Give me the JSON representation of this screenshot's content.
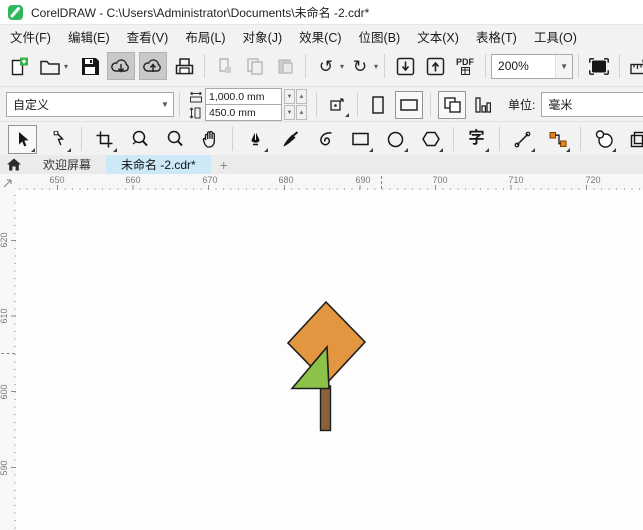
{
  "window": {
    "title": "CorelDRAW - C:\\Users\\Administrator\\Documents\\未命名 -2.cdr*"
  },
  "menu": {
    "items": [
      "文件(F)",
      "编辑(E)",
      "查看(V)",
      "布局(L)",
      "对象(J)",
      "效果(C)",
      "位图(B)",
      "文本(X)",
      "表格(T)",
      "工具(O)"
    ]
  },
  "toolbar": {
    "zoom_level": "200%",
    "pdf_label": "PDF"
  },
  "property_bar": {
    "page_preset": "自定义",
    "page_width": "1,000.0 mm",
    "page_height": "450.0 mm",
    "units_label": "单位:",
    "units_value": "毫米"
  },
  "toolbox": {
    "text_tool_glyph": "字"
  },
  "tabs": {
    "welcome": "欢迎屏幕",
    "document": "未命名 -2.cdr*",
    "new_tab": "+"
  },
  "rulers": {
    "horizontal_labels": [
      "650",
      "660",
      "670",
      "680",
      "690",
      "700",
      "710",
      "720"
    ],
    "vertical_labels": [
      "620",
      "610",
      "600",
      "590"
    ]
  },
  "canvas": {
    "tree": {
      "crown_fill": "#E2963F",
      "leaf_fill": "#8DC248",
      "trunk_fill": "#8A6239",
      "outline": "#1E1E1E"
    }
  },
  "colors": {
    "accent_blue": "#2B9CD8",
    "active_tab_bg": "#CDE8F7",
    "logo_green": "#2EB75C"
  }
}
